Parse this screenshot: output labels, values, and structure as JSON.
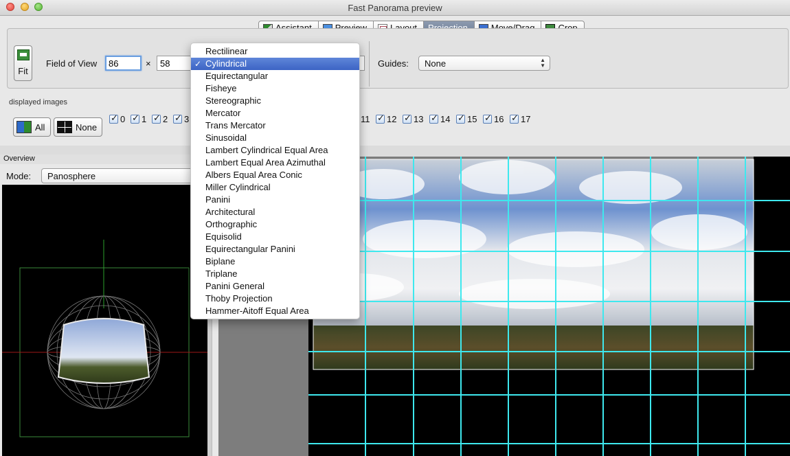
{
  "window": {
    "title": "Fast Panorama preview"
  },
  "tabs": [
    {
      "label": "Assistant",
      "icon": "assistant-icon"
    },
    {
      "label": "Preview",
      "icon": "preview-icon"
    },
    {
      "label": "Layout",
      "icon": "layout-icon"
    },
    {
      "label": "Projection",
      "icon": "",
      "active": true
    },
    {
      "label": "Move/Drag",
      "icon": "move-drag-icon"
    },
    {
      "label": "Crop",
      "icon": "crop-icon"
    }
  ],
  "toolbar": {
    "fit_label": "Fit",
    "fov_label": "Field of View",
    "fov_h": "86",
    "fov_times": "×",
    "fov_v": "58",
    "guides_label": "Guides:",
    "guides_value": "None"
  },
  "displayed_images": {
    "label": "displayed images",
    "all_label": "All",
    "none_label": "None",
    "checked_visible": [
      "0",
      "1",
      "2",
      "3",
      "11",
      "12",
      "13",
      "14",
      "15",
      "16",
      "17"
    ]
  },
  "overview": {
    "header": "Overview",
    "mode_label": "Mode:",
    "mode_value": "Panosphere"
  },
  "projection_menu": {
    "selected_index": 1,
    "items": [
      "Rectilinear",
      "Cylindrical",
      "Equirectangular",
      "Fisheye",
      "Stereographic",
      "Mercator",
      "Trans Mercator",
      "Sinusoidal",
      "Lambert Cylindrical Equal Area",
      "Lambert Equal Area Azimuthal",
      "Albers Equal Area Conic",
      "Miller Cylindrical",
      "Panini",
      "Architectural",
      "Orthographic",
      "Equisolid",
      "Equirectangular Panini",
      "Biplane",
      "Triplane",
      "Panini General",
      "Thoby Projection",
      "Hammer-Aitoff Equal Area"
    ]
  },
  "colors": {
    "grid": "#3ee8ee",
    "selection": "#3c64c4",
    "sky": "#5d86c7",
    "ground": "#3b4a22"
  }
}
